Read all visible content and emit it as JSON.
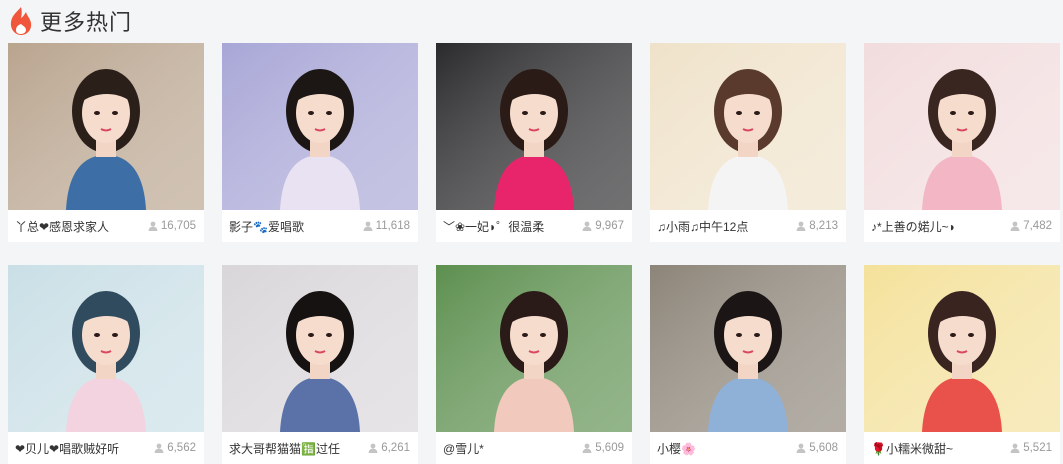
{
  "section": {
    "title": "更多热门",
    "icon": "fire-icon",
    "accent": "#f0563c"
  },
  "cards": [
    {
      "title": "丫总❤感恩求家人",
      "viewers": "16,705",
      "bg": "#b9a48e",
      "accent": "#3d6fa6",
      "hair": "#2b1f1a"
    },
    {
      "title": "影子🐾爱唱歌",
      "viewers": "11,618",
      "bg": "#a8a6d6",
      "accent": "#e9e2f2",
      "hair": "#1c1614"
    },
    {
      "title": "﹀❀一妃◗゜很温柔",
      "viewers": "9,967",
      "bg": "#2a2a2c",
      "accent": "#e8246a",
      "hair": "#2a1b16"
    },
    {
      "title": "♫小雨♫中午12点",
      "viewers": "8,213",
      "bg": "#efe2c9",
      "accent": "#f4f4f4",
      "hair": "#5a3a2c"
    },
    {
      "title": "♪*上善の婼儿~◗",
      "viewers": "7,482",
      "bg": "#f2dcdd",
      "accent": "#f3b6c4",
      "hair": "#3a2620"
    },
    {
      "title": "❤贝儿❤唱歌贼好听",
      "viewers": "6,562",
      "bg": "#c9dfe6",
      "accent": "#f3d3e0",
      "hair": "#304a5e"
    },
    {
      "title": "求大哥帮猫猫🈯过任",
      "viewers": "6,261",
      "bg": "#d9d6da",
      "accent": "#5b72a8",
      "hair": "#161212"
    },
    {
      "title": "@雪儿*",
      "viewers": "5,609",
      "bg": "#5c8f4e",
      "accent": "#f1c9bd",
      "hair": "#2a1a18"
    },
    {
      "title": "小樱🌸",
      "viewers": "5,608",
      "bg": "#8c8478",
      "accent": "#8fb1d8",
      "hair": "#1b1515"
    },
    {
      "title": "🌹小糯米微甜~",
      "viewers": "5,521",
      "bg": "#f4e19a",
      "accent": "#e8524a",
      "hair": "#3a2420"
    }
  ]
}
